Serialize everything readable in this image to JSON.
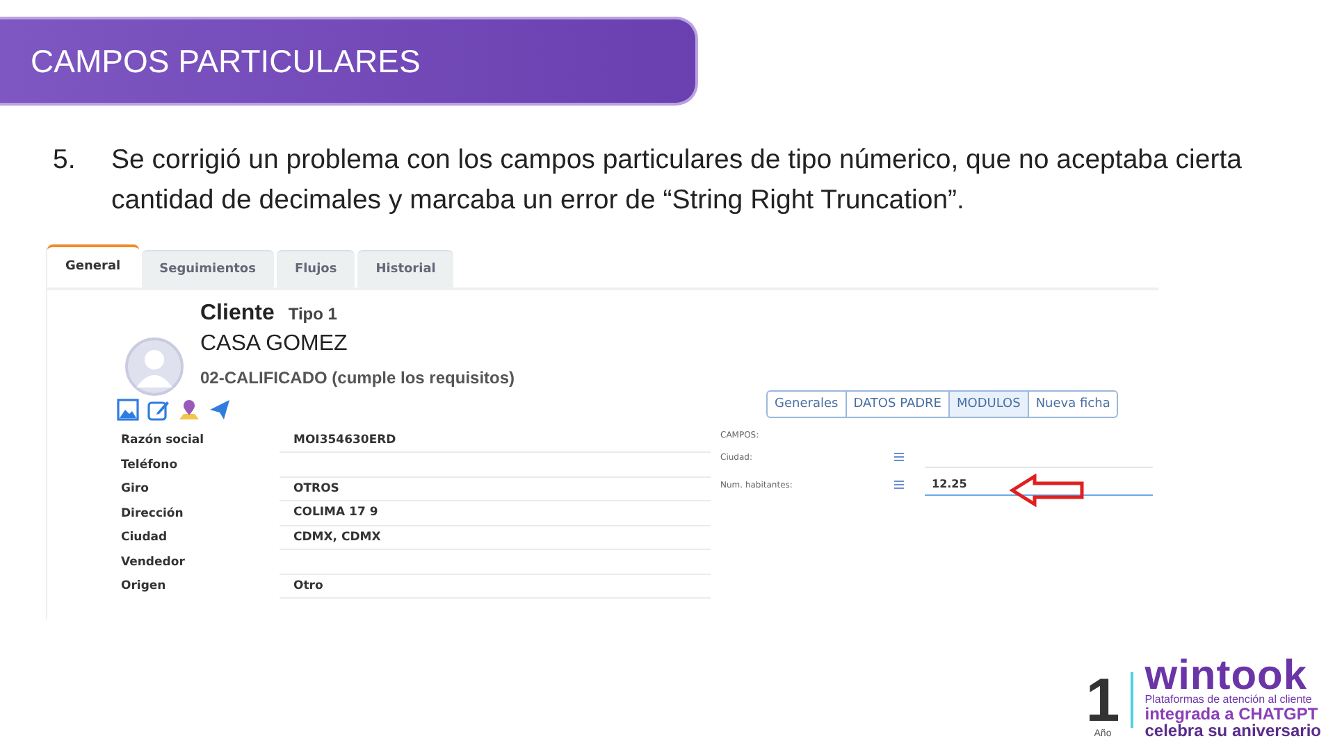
{
  "header": {
    "title": "CAMPOS PARTICULARES"
  },
  "points": [
    {
      "number": "5.",
      "text": "Se corrigió un problema con los campos particulares de tipo númerico, que no aceptaba cierta cantidad de decimales y marcaba un error de “String Right Truncation”."
    }
  ],
  "screenshot": {
    "tabs": [
      {
        "label": "General",
        "selected": true
      },
      {
        "label": "Seguimientos",
        "selected": false
      },
      {
        "label": "Flujos",
        "selected": false
      },
      {
        "label": "Historial",
        "selected": false
      }
    ],
    "record": {
      "title": "Cliente",
      "type": "Tipo 1",
      "name": "CASA GOMEZ",
      "status": "02-CALIFICADO (cumple los requisitos)"
    },
    "fields": [
      {
        "label": "Razón social",
        "value": "MOI354630ERD"
      },
      {
        "label": "Teléfono"
      },
      {
        "label": "Giro",
        "value": "OTROS"
      },
      {
        "label": "Dirección",
        "value": "COLIMA 17 9"
      },
      {
        "label": "Ciudad",
        "value": "CDMX, CDMX"
      },
      {
        "label": "Vendedor"
      },
      {
        "label": "Origen",
        "value": "Otro"
      }
    ],
    "section_buttons": [
      {
        "label": "Generales",
        "selected": false
      },
      {
        "label": "DATOS PADRE",
        "selected": false
      },
      {
        "label": "MODULOS",
        "selected": true
      },
      {
        "label": "Nueva ficha",
        "selected": false
      }
    ],
    "custom_heading": "CAMPOS:",
    "custom_fields": [
      {
        "label": "Ciudad:",
        "focused": false
      },
      {
        "label": "Num. habitantes:",
        "value": "12.25",
        "focused": true,
        "arrow": true
      }
    ]
  },
  "logo": {
    "number": "1",
    "year": "Año",
    "brand": "wintook",
    "tagline": "Plataformas de atención al cliente",
    "line_1": "integrada a CHATGPT",
    "line_2": "celebra su aniversario"
  }
}
